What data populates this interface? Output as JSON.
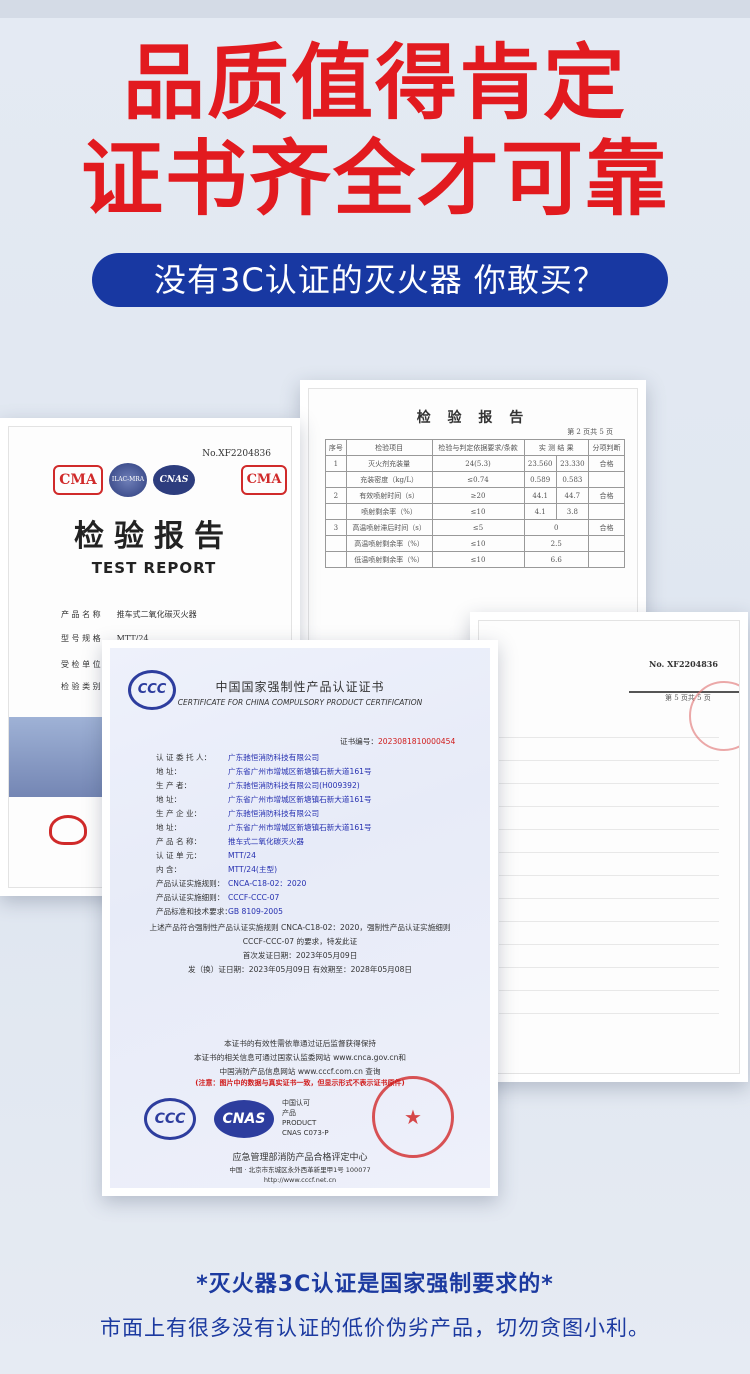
{
  "headline": {
    "line1": "品质值得肯定",
    "line2": "证书齐全才可靠"
  },
  "banner": "没有3C认证的灭火器 你敢买？",
  "report_right": {
    "title": "检 验 报 告",
    "page": "第 2 页共 5 页",
    "head": [
      "序号",
      "检验项目",
      "检验与判定依据要求/条款",
      "实 测 结 果",
      "分项判断"
    ],
    "rows": [
      [
        "1",
        "灭火剂充装量",
        "24(5.3)",
        "23.560",
        "23.330",
        "合格"
      ],
      [
        "",
        "充装密度（kg/L）",
        "≤0.74",
        "0.589",
        "0.583",
        ""
      ],
      [
        "2",
        "有效喷射时间（s）",
        "≥20",
        "44.1",
        "44.7",
        "合格"
      ],
      [
        "",
        "喷射剩余率（%）",
        "≤10",
        "4.1",
        "3.8",
        ""
      ],
      [
        "3",
        "高温喷射滞后时间（s）",
        "≤5",
        "0",
        "",
        "合格"
      ],
      [
        "",
        "高温喷射剩余率（%）",
        "≤10",
        "2.5",
        "",
        ""
      ],
      [
        "",
        "低温喷射剩余率（%）",
        "≤10",
        "6.6",
        "",
        ""
      ]
    ]
  },
  "report_left": {
    "number": "No.XF2204836",
    "logos": [
      "CMA",
      "ILAC-MRA",
      "CNAS",
      "CMA"
    ],
    "title": "检验报告",
    "subtitle": "TEST REPORT",
    "fields": [
      {
        "label": "产 品 名 称",
        "value": "推车式二氧化碳灭火器"
      },
      {
        "label": "型 号 规 格",
        "value": "MTT/24"
      },
      {
        "label": "受 检 单 位",
        "value": ""
      },
      {
        "label": "检 验 类 别",
        "value": ""
      }
    ]
  },
  "report_right2": {
    "number": "No. XF2204836",
    "page": "第 5 页共 5 页"
  },
  "certificate": {
    "title_cn": "中国国家强制性产品认证证书",
    "title_en": "CERTIFICATE FOR CHINA COMPULSORY PRODUCT CERTIFICATION",
    "cert_no_label": "证书编号：",
    "cert_no": "2023081810000454",
    "fields": [
      {
        "k": "认 证 委 托 人：",
        "v": "广东驰恒消防科技有限公司"
      },
      {
        "k": "地        址：",
        "v": "广东省广州市增城区新塘镇石新大道161号"
      },
      {
        "k": "生   产   者：",
        "v": "广东驰恒消防科技有限公司(H009392)"
      },
      {
        "k": "地        址：",
        "v": "广东省广州市增城区新塘镇石新大道161号"
      },
      {
        "k": "生 产 企 业：",
        "v": "广东驰恒消防科技有限公司"
      },
      {
        "k": "地        址：",
        "v": "广东省广州市增城区新塘镇石新大道161号"
      },
      {
        "k": "产 品 名 称：",
        "v": "推车式二氧化碳灭火器"
      },
      {
        "k": "认 证 单 元：",
        "v": "MTT/24"
      },
      {
        "k": "内        含：",
        "v": "MTT/24(主型)"
      },
      {
        "k": "产品认证实施规则：",
        "v": "CNCA-C18-02：2020"
      },
      {
        "k": "产品认证实施细则：",
        "v": "CCCF-CCC-07"
      },
      {
        "k": "产品标准和技术要求：",
        "v": "GB 8109-2005"
      }
    ],
    "stmt1": "上述产品符合强制性产品认证实施规则 CNCA-C18-02：2020，强制性产品认证实施细则",
    "stmt2": "CCCF-CCC-07 的要求，特发此证",
    "first_issue": "首次发证日期：2023年05月09日",
    "issue_line": "发（换）证日期：2023年05月09日   有效期至：2028年05月08日",
    "note1": "本证书的有效性需依靠通过证后监督获得保持",
    "note2": "本证书的相关信息可通过国家认监委网站 www.cnca.gov.cn和",
    "note3": "中国消防产品信息网站 www.cccf.com.cn 查询",
    "note_red": "(注意：图片中的数据与真实证书一致，但显示形式不表示证书原件)",
    "cnas_text": [
      "中国认可",
      "产品",
      "PRODUCT",
      "CNAS C073-P"
    ],
    "ccc": "CCC",
    "cnas": "CNAS",
    "issuer": "应急管理部消防产品合格评定中心",
    "address": "中国 · 北京市东城区永外西革新里甲1号    100077",
    "website": "http://www.cccf.net.cn"
  },
  "bottom": {
    "line1": "*灭火器3C认证是国家强制要求的*",
    "line2": "市面上有很多没有认证的低价伪劣产品，切勿贪图小利。"
  }
}
